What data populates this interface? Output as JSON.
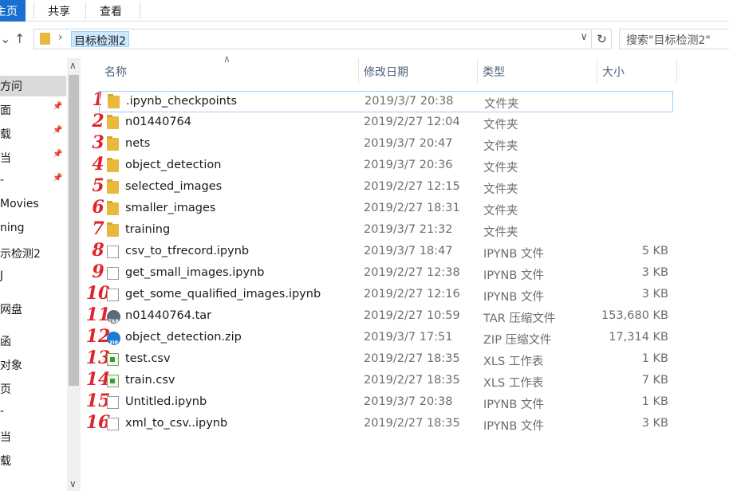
{
  "ribbon": {
    "tabs": [
      "主页",
      "共享",
      "查看"
    ]
  },
  "address": {
    "crumb": "目标检测2",
    "search_placeholder": "搜索\"目标检测2\""
  },
  "sidebar": {
    "items": [
      {
        "label": "方问",
        "pinned": false,
        "active": true
      },
      {
        "label": "面",
        "pinned": true
      },
      {
        "label": "载",
        "pinned": true
      },
      {
        "label": "当",
        "pinned": true
      },
      {
        "label": "‐",
        "pinned": true
      },
      {
        "label": "Movies",
        "pinned": false
      },
      {
        "label": "ning",
        "pinned": false
      },
      {
        "label": "示检测2",
        "pinned": false
      },
      {
        "label": "J",
        "pinned": false
      },
      {
        "label": "网盘",
        "pinned": false
      },
      {
        "label": "函",
        "pinned": false
      },
      {
        "label": "对象",
        "pinned": false
      },
      {
        "label": "页",
        "pinned": false
      },
      {
        "label": "‐",
        "pinned": false
      },
      {
        "label": "当",
        "pinned": false
      },
      {
        "label": "载",
        "pinned": false
      }
    ]
  },
  "columns": {
    "name": "名称",
    "date": "修改日期",
    "type": "类型",
    "size": "大小"
  },
  "files": [
    {
      "anno": "1",
      "icon": "folder",
      "name": ".ipynb_checkpoints",
      "date": "2019/3/7 20:38",
      "type": "文件夹",
      "size": "",
      "selected": true
    },
    {
      "anno": "2",
      "icon": "folder",
      "name": "n01440764",
      "date": "2019/2/27 12:04",
      "type": "文件夹",
      "size": ""
    },
    {
      "anno": "3",
      "icon": "folder",
      "name": "nets",
      "date": "2019/3/7 20:47",
      "type": "文件夹",
      "size": ""
    },
    {
      "anno": "4",
      "icon": "folder",
      "name": "object_detection",
      "date": "2019/3/7 20:36",
      "type": "文件夹",
      "size": ""
    },
    {
      "anno": "5",
      "icon": "folder",
      "name": "selected_images",
      "date": "2019/2/27 12:15",
      "type": "文件夹",
      "size": ""
    },
    {
      "anno": "6",
      "icon": "folder",
      "name": "smaller_images",
      "date": "2019/2/27 18:31",
      "type": "文件夹",
      "size": ""
    },
    {
      "anno": "7",
      "icon": "folder",
      "name": "training",
      "date": "2019/3/7 21:32",
      "type": "文件夹",
      "size": ""
    },
    {
      "anno": "8",
      "icon": "file",
      "name": "csv_to_tfrecord.ipynb",
      "date": "2019/3/7 18:47",
      "type": "IPYNB 文件",
      "size": "5 KB"
    },
    {
      "anno": "9",
      "icon": "file",
      "name": "get_small_images.ipynb",
      "date": "2019/2/27 12:38",
      "type": "IPYNB 文件",
      "size": "3 KB"
    },
    {
      "anno": "10",
      "icon": "file",
      "name": "get_some_qualified_images.ipynb",
      "date": "2019/2/27 12:16",
      "type": "IPYNB 文件",
      "size": "3 KB"
    },
    {
      "anno": "11",
      "icon": "tar",
      "name": "n01440764.tar",
      "date": "2019/2/27 10:59",
      "type": "TAR 压缩文件",
      "size": "153,680 KB"
    },
    {
      "anno": "12",
      "icon": "zip",
      "name": "object_detection.zip",
      "date": "2019/3/7 17:51",
      "type": "ZIP 压缩文件",
      "size": "17,314 KB"
    },
    {
      "anno": "13",
      "icon": "csv",
      "name": "test.csv",
      "date": "2019/2/27 18:35",
      "type": "XLS 工作表",
      "size": "1 KB"
    },
    {
      "anno": "14",
      "icon": "csv",
      "name": "train.csv",
      "date": "2019/2/27 18:35",
      "type": "XLS 工作表",
      "size": "7 KB"
    },
    {
      "anno": "15",
      "icon": "file",
      "name": "Untitled.ipynb",
      "date": "2019/3/7 20:38",
      "type": "IPYNB 文件",
      "size": "1 KB"
    },
    {
      "anno": "16",
      "icon": "file",
      "name": "xml_to_csv..ipynb",
      "date": "2019/2/27 18:35",
      "type": "IPYNB 文件",
      "size": "3 KB"
    }
  ],
  "archive_labels": {
    "tar": "TAR",
    "zip": "ZIP"
  }
}
